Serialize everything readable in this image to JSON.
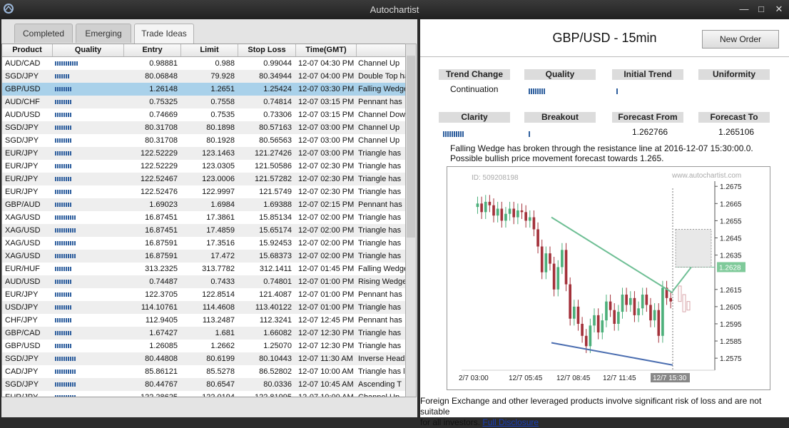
{
  "window": {
    "title": "Autochartist"
  },
  "tabs": [
    {
      "label": "Completed"
    },
    {
      "label": "Emerging"
    },
    {
      "label": "Trade Ideas"
    }
  ],
  "table": {
    "headers": [
      "Product",
      "Quality",
      "Entry",
      "Limit",
      "Stop Loss",
      "Time(GMT)"
    ],
    "rows": [
      {
        "product": "AUD/CAD",
        "quality": 0.55,
        "entry": "0.98881",
        "limit": "0.988",
        "stop": "0.99044",
        "time": "12-07 04:30 PM",
        "pattern": "Channel Up"
      },
      {
        "product": "SGD/JPY",
        "quality": 0.35,
        "entry": "80.06848",
        "limit": "79.928",
        "stop": "80.34944",
        "time": "12-07 04:00 PM",
        "pattern": "Double Top has"
      },
      {
        "product": "GBP/USD",
        "quality": 0.4,
        "entry": "1.26148",
        "limit": "1.2651",
        "stop": "1.25424",
        "time": "12-07 03:30 PM",
        "pattern": "Falling Wedge"
      },
      {
        "product": "AUD/CHF",
        "quality": 0.4,
        "entry": "0.75325",
        "limit": "0.7558",
        "stop": "0.74814",
        "time": "12-07 03:15 PM",
        "pattern": "Pennant has"
      },
      {
        "product": "AUD/USD",
        "quality": 0.4,
        "entry": "0.74669",
        "limit": "0.7535",
        "stop": "0.73306",
        "time": "12-07 03:15 PM",
        "pattern": "Channel Dow"
      },
      {
        "product": "SGD/JPY",
        "quality": 0.4,
        "entry": "80.31708",
        "limit": "80.1898",
        "stop": "80.57163",
        "time": "12-07 03:00 PM",
        "pattern": "Channel Up"
      },
      {
        "product": "SGD/JPY",
        "quality": 0.4,
        "entry": "80.31708",
        "limit": "80.1928",
        "stop": "80.56563",
        "time": "12-07 03:00 PM",
        "pattern": "Channel Up"
      },
      {
        "product": "EUR/JPY",
        "quality": 0.4,
        "entry": "122.52229",
        "limit": "123.1463",
        "stop": "121.27426",
        "time": "12-07 03:00 PM",
        "pattern": "Triangle has"
      },
      {
        "product": "EUR/JPY",
        "quality": 0.4,
        "entry": "122.52229",
        "limit": "123.0305",
        "stop": "121.50586",
        "time": "12-07 02:30 PM",
        "pattern": "Triangle has"
      },
      {
        "product": "EUR/JPY",
        "quality": 0.4,
        "entry": "122.52467",
        "limit": "123.0006",
        "stop": "121.57282",
        "time": "12-07 02:30 PM",
        "pattern": "Triangle has"
      },
      {
        "product": "EUR/JPY",
        "quality": 0.4,
        "entry": "122.52476",
        "limit": "122.9997",
        "stop": "121.5749",
        "time": "12-07 02:30 PM",
        "pattern": "Triangle has"
      },
      {
        "product": "GBP/AUD",
        "quality": 0.4,
        "entry": "1.69023",
        "limit": "1.6984",
        "stop": "1.69388",
        "time": "12-07 02:15 PM",
        "pattern": "Pennant has"
      },
      {
        "product": "XAG/USD",
        "quality": 0.5,
        "entry": "16.87451",
        "limit": "17.3861",
        "stop": "15.85134",
        "time": "12-07 02:00 PM",
        "pattern": "Triangle has"
      },
      {
        "product": "XAG/USD",
        "quality": 0.5,
        "entry": "16.87451",
        "limit": "17.4859",
        "stop": "15.65174",
        "time": "12-07 02:00 PM",
        "pattern": "Triangle has"
      },
      {
        "product": "XAG/USD",
        "quality": 0.5,
        "entry": "16.87591",
        "limit": "17.3516",
        "stop": "15.92453",
        "time": "12-07 02:00 PM",
        "pattern": "Triangle has"
      },
      {
        "product": "XAG/USD",
        "quality": 0.5,
        "entry": "16.87591",
        "limit": "17.472",
        "stop": "15.68373",
        "time": "12-07 02:00 PM",
        "pattern": "Triangle has"
      },
      {
        "product": "EUR/HUF",
        "quality": 0.4,
        "entry": "313.2325",
        "limit": "313.7782",
        "stop": "312.1411",
        "time": "12-07 01:45 PM",
        "pattern": "Falling Wedge"
      },
      {
        "product": "AUD/USD",
        "quality": 0.4,
        "entry": "0.74487",
        "limit": "0.7433",
        "stop": "0.74801",
        "time": "12-07 01:00 PM",
        "pattern": "Rising Wedge"
      },
      {
        "product": "EUR/JPY",
        "quality": 0.4,
        "entry": "122.3705",
        "limit": "122.8514",
        "stop": "121.4087",
        "time": "12-07 01:00 PM",
        "pattern": "Pennant has"
      },
      {
        "product": "USD/JPY",
        "quality": 0.4,
        "entry": "114.10761",
        "limit": "114.4608",
        "stop": "113.40122",
        "time": "12-07 01:00 PM",
        "pattern": "Triangle has"
      },
      {
        "product": "CHF/JPY",
        "quality": 0.4,
        "entry": "112.9405",
        "limit": "113.2487",
        "stop": "112.3241",
        "time": "12-07 12:45 PM",
        "pattern": "Pennant has"
      },
      {
        "product": "GBP/CAD",
        "quality": 0.4,
        "entry": "1.67427",
        "limit": "1.681",
        "stop": "1.66082",
        "time": "12-07 12:30 PM",
        "pattern": "Triangle has"
      },
      {
        "product": "GBP/USD",
        "quality": 0.4,
        "entry": "1.26085",
        "limit": "1.2662",
        "stop": "1.25070",
        "time": "12-07 12:30 PM",
        "pattern": "Triangle has"
      },
      {
        "product": "SGD/JPY",
        "quality": 0.5,
        "entry": "80.44808",
        "limit": "80.6199",
        "stop": "80.10443",
        "time": "12-07 11:30 AM",
        "pattern": "Inverse Head"
      },
      {
        "product": "CAD/JPY",
        "quality": 0.5,
        "entry": "85.86121",
        "limit": "85.5278",
        "stop": "86.52802",
        "time": "12-07 10:00 AM",
        "pattern": "Triangle has l"
      },
      {
        "product": "SGD/JPY",
        "quality": 0.5,
        "entry": "80.44767",
        "limit": "80.6547",
        "stop": "80.0336",
        "time": "12-07 10:45 AM",
        "pattern": "Ascending T"
      },
      {
        "product": "EUR/JPY",
        "quality": 0.5,
        "entry": "122.28625",
        "limit": "122.0194",
        "stop": "122.81995",
        "time": "12-07 10:00 AM",
        "pattern": "Channel Up"
      }
    ]
  },
  "detail": {
    "title": "GBP/USD - 15min",
    "new_order_label": "New Order",
    "metrics": {
      "trend_change": {
        "label": "Trend Change",
        "value": "Continuation"
      },
      "quality": {
        "label": "Quality",
        "level": 0.4
      },
      "initial_trend": {
        "label": "Initial Trend",
        "level": 0.05
      },
      "uniformity": {
        "label": "Uniformity"
      },
      "clarity": {
        "label": "Clarity",
        "level": 0.5
      },
      "breakout": {
        "label": "Breakout",
        "level": 0.05
      },
      "forecast_from": {
        "label": "Forecast From",
        "value": "1.262766"
      },
      "forecast_to": {
        "label": "Forecast To",
        "value": "1.265106"
      }
    },
    "description_line1": "Falling Wedge has broken through the resistance line at 2016-12-07 15:30:00.0.",
    "description_line2": "Possible bullish price movement forecast towards 1.265.",
    "disclaimer": "Foreign Exchange and other leveraged products involve significant risk of loss and are not suitable",
    "disclaimer2": "for all investors.",
    "disclaimer_link": "Full Disclosure"
  },
  "chart_data": {
    "type": "candlestick",
    "id_label": "ID: 509208198",
    "watermark": "www.autochartist.com",
    "y_ticks": [
      "1.2675",
      "1.2665",
      "1.2655",
      "1.2645",
      "1.2635",
      "1.2628",
      "1.2615",
      "1.2605",
      "1.2595",
      "1.2585",
      "1.2575"
    ],
    "ylim": [
      1.2568,
      1.2678
    ],
    "x_ticks": [
      "2/7 03:00",
      "12/7 05:45",
      "12/7 08:45",
      "12/7 11:45",
      "12/7 15:30"
    ],
    "current_price": "1.2628",
    "colors": {
      "up": "#4caf7a",
      "down": "#a3313a",
      "resistance": "#6fbf95",
      "support": "#4a6db0",
      "price_label_bg": "#7fca9a"
    }
  }
}
